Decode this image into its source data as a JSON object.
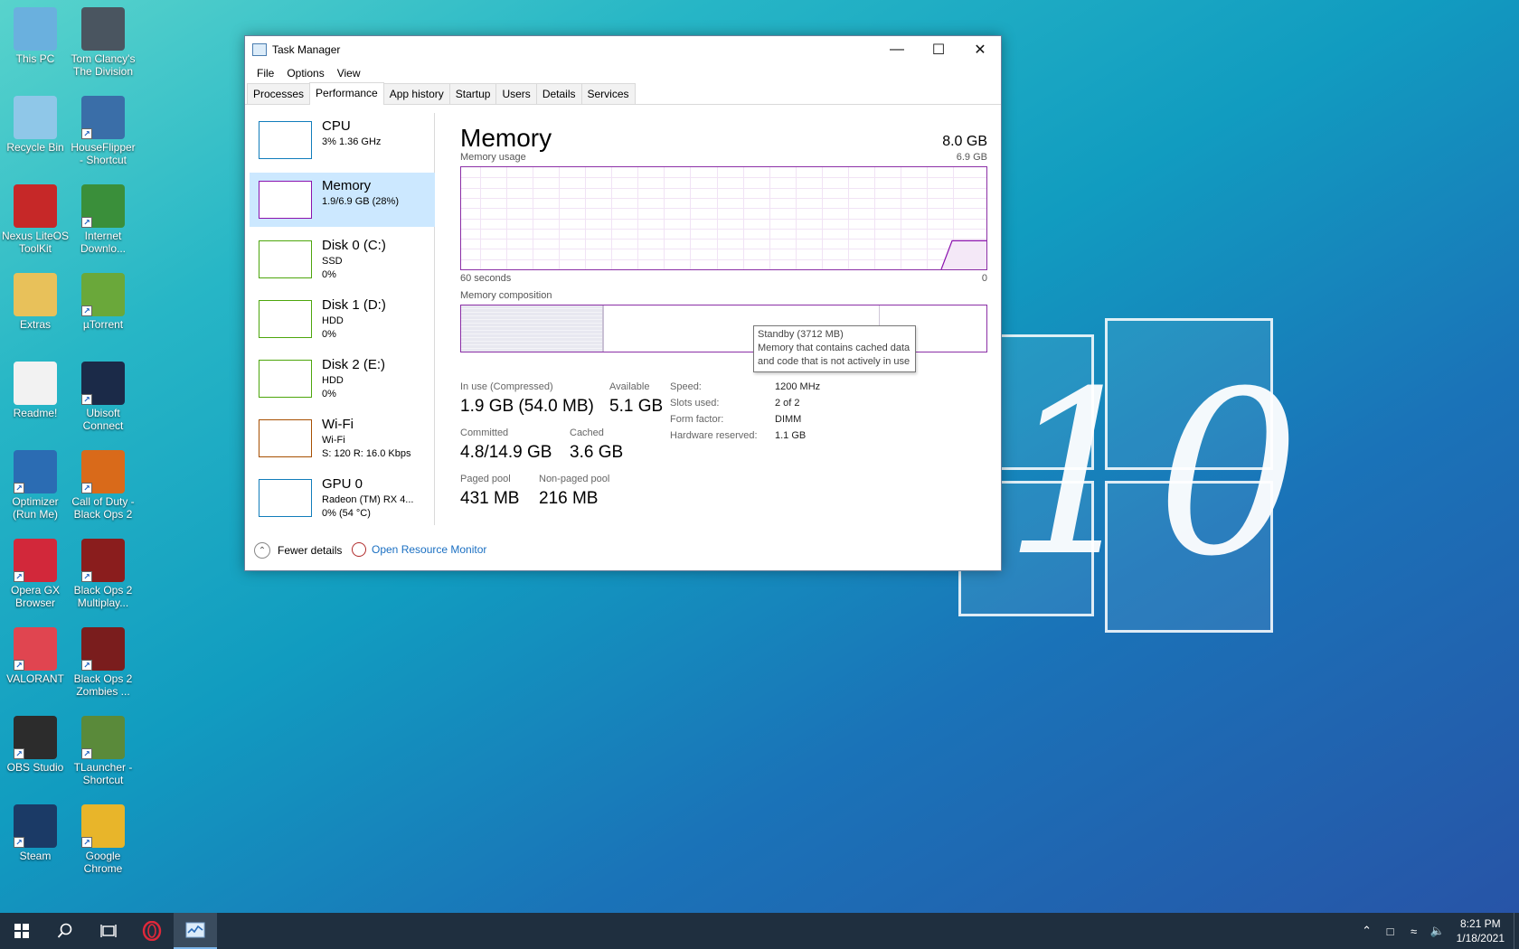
{
  "desktop": {
    "icons": [
      {
        "label": "This PC",
        "icon": "this-pc-icon",
        "color": "#6ab0de"
      },
      {
        "label": "Tom Clancy's The Division",
        "icon": "division-icon",
        "color": "#4a5560"
      },
      {
        "label": "Recycle Bin",
        "icon": "recycle-bin-icon",
        "color": "#8fc7e8"
      },
      {
        "label": "HouseFlipper - Shortcut",
        "icon": "houseflipper-icon",
        "color": "#3a6ea8"
      },
      {
        "label": "Nexus LiteOS ToolKit",
        "icon": "nexus-icon",
        "color": "#c62828"
      },
      {
        "label": "Internet Downlo...",
        "icon": "idm-icon",
        "color": "#3a8f3a"
      },
      {
        "label": "Extras",
        "icon": "folder-icon",
        "color": "#e8c15a"
      },
      {
        "label": "µTorrent",
        "icon": "utorrent-icon",
        "color": "#6aa83a"
      },
      {
        "label": "Readme!",
        "icon": "document-icon",
        "color": "#f2f2f2"
      },
      {
        "label": "Ubisoft Connect",
        "icon": "ubisoft-icon",
        "color": "#1b2a48"
      },
      {
        "label": "Optimizer (Run Me)",
        "icon": "optimizer-icon",
        "color": "#2b6cb3"
      },
      {
        "label": "Call of Duty - Black Ops 2",
        "icon": "bo2-icon",
        "color": "#d96a1a"
      },
      {
        "label": "Opera GX Browser",
        "icon": "opera-gx-icon",
        "color": "#d2283a"
      },
      {
        "label": "Black Ops 2 Multiplay...",
        "icon": "bo2-mp-icon",
        "color": "#8a1d1d"
      },
      {
        "label": "VALORANT",
        "icon": "valorant-icon",
        "color": "#e04550"
      },
      {
        "label": "Black Ops 2 Zombies ...",
        "icon": "bo2-zombies-icon",
        "color": "#7a1d1d"
      },
      {
        "label": "OBS Studio",
        "icon": "obs-icon",
        "color": "#2c2c2c"
      },
      {
        "label": "TLauncher - Shortcut",
        "icon": "tlauncher-icon",
        "color": "#5a8a3a"
      },
      {
        "label": "Steam",
        "icon": "steam-icon",
        "color": "#1b3a66"
      },
      {
        "label": "Google Chrome",
        "icon": "chrome-icon",
        "color": "#e8b52a"
      }
    ]
  },
  "window": {
    "title": "Task Manager",
    "menu": [
      "File",
      "Options",
      "View"
    ],
    "tabs": [
      "Processes",
      "Performance",
      "App history",
      "Startup",
      "Users",
      "Details",
      "Services"
    ],
    "active_tab": "Performance"
  },
  "sidebar": {
    "items": [
      {
        "name": "CPU",
        "line1": "3% 1.36 GHz",
        "line2": "",
        "color": "#117dbb",
        "selected": false
      },
      {
        "name": "Memory",
        "line1": "1.9/6.9 GB (28%)",
        "line2": "",
        "color": "#8b12ae",
        "selected": true
      },
      {
        "name": "Disk 0 (C:)",
        "line1": "SSD",
        "line2": "0%",
        "color": "#4da60c",
        "selected": false
      },
      {
        "name": "Disk 1 (D:)",
        "line1": "HDD",
        "line2": "0%",
        "color": "#4da60c",
        "selected": false
      },
      {
        "name": "Disk 2 (E:)",
        "line1": "HDD",
        "line2": "0%",
        "color": "#4da60c",
        "selected": false
      },
      {
        "name": "Wi-Fi",
        "line1": "Wi-Fi",
        "line2": "S: 120 R: 16.0 Kbps",
        "color": "#a74f01",
        "selected": false
      },
      {
        "name": "GPU 0",
        "line1": "Radeon (TM) RX 4...",
        "line2": "0% (54 °C)",
        "color": "#117dbb",
        "selected": false
      }
    ]
  },
  "memory": {
    "title": "Memory",
    "total": "8.0 GB",
    "usage_label": "Memory usage",
    "usage_max": "6.9 GB",
    "axis_left": "60 seconds",
    "axis_right": "0",
    "composition_label": "Memory composition",
    "usage_fraction": 0.28,
    "tooltip": {
      "title": "Standby (3712 MB)",
      "line1": "Memory that contains cached data",
      "line2": "and code that is not actively in use"
    },
    "stats": {
      "in_use_label": "In use (Compressed)",
      "in_use": "1.9 GB (54.0 MB)",
      "available_label": "Available",
      "available": "5.1 GB",
      "committed_label": "Committed",
      "committed": "4.8/14.9 GB",
      "cached_label": "Cached",
      "cached": "3.6 GB",
      "paged_label": "Paged pool",
      "paged": "431 MB",
      "nonpaged_label": "Non-paged pool",
      "nonpaged": "216 MB"
    },
    "properties": {
      "speed_label": "Speed:",
      "speed": "1200 MHz",
      "slots_label": "Slots used:",
      "slots": "2 of 2",
      "form_label": "Form factor:",
      "form": "DIMM",
      "reserved_label": "Hardware reserved:",
      "reserved": "1.1 GB"
    },
    "accent_color": "#8b12ae"
  },
  "footer": {
    "fewer_details": "Fewer details",
    "open_resource_monitor": "Open Resource Monitor"
  },
  "taskbar": {
    "time": "8:21 PM",
    "date": "1/18/2021"
  }
}
